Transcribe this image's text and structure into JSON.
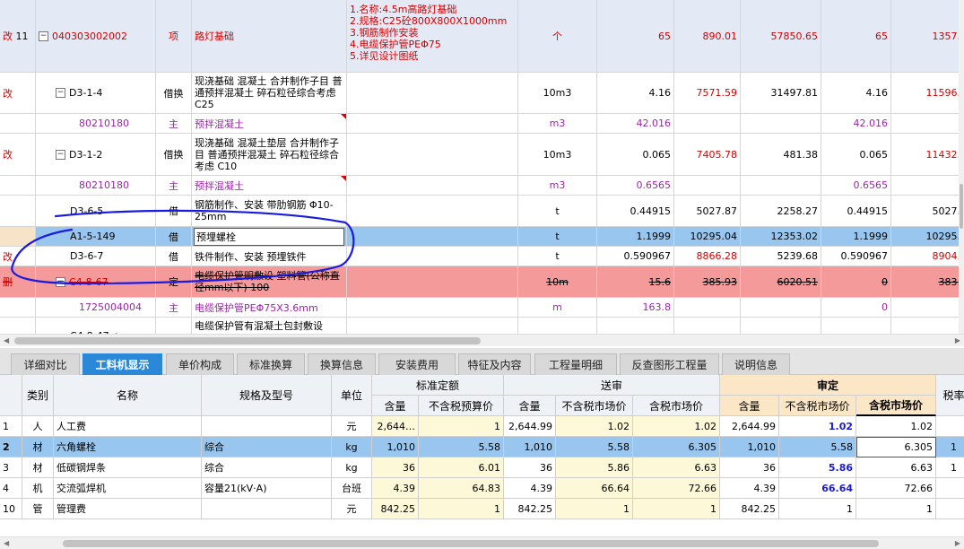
{
  "upper_rows": [
    {
      "flag": "改",
      "num": "11",
      "code": "040303002002",
      "type": "项",
      "name": "路灯基础",
      "features": [
        "1.名称:4.5m高路灯基础",
        "2.规格:C25砼800X800X1000mm",
        "3.钢筋制作安装",
        "4.电缆保护管PEΦ75",
        "5.详见设计图纸"
      ],
      "unit": "个",
      "qty": "65",
      "price": "890.01",
      "total": "57850.65",
      "qty2": "65",
      "p2": "1357."
    },
    {
      "flag": "改",
      "code": "D3-1-4",
      "type": "借换",
      "name": "现浇基础 混凝土 合并制作子目 普通预拌混凝土 碎石粒径综合考虑 C25",
      "unit": "10m3",
      "qty": "4.16",
      "price": "7571.59",
      "total": "31497.81",
      "qty2": "4.16",
      "p2": "11596."
    },
    {
      "code": "80210180",
      "type": "主",
      "name": "预拌混凝土",
      "unit": "m3",
      "qty": "42.016",
      "qty2": "42.016"
    },
    {
      "flag": "改",
      "code": "D3-1-2",
      "type": "借换",
      "name": "现浇基础 混凝土垫层 合并制作子目 普通预拌混凝土 碎石粒径综合考虑 C10",
      "unit": "10m3",
      "qty": "0.065",
      "price": "7405.78",
      "total": "481.38",
      "qty2": "0.065",
      "p2": "11432."
    },
    {
      "code": "80210180",
      "type": "主",
      "name": "预拌混凝土",
      "unit": "m3",
      "qty": "0.6565",
      "qty2": "0.6565"
    },
    {
      "code": "D3-6-5",
      "type": "借",
      "name": "钢筋制作、安装 带肋钢筋 Φ10-25mm",
      "unit": "t",
      "qty": "0.44915",
      "price": "5027.87",
      "total": "2258.27",
      "qty2": "0.44915",
      "p2": "5027."
    },
    {
      "code": "A1-5-149",
      "type": "借",
      "name": "预埋螺栓",
      "unit": "t",
      "qty": "1.1999",
      "price": "10295.04",
      "total": "12353.02",
      "qty2": "1.1999",
      "p2": "10295."
    },
    {
      "flag": "改",
      "code": "D3-6-7",
      "type": "借",
      "name": "铁件制作、安装 预埋铁件",
      "unit": "t",
      "qty": "0.590967",
      "price": "8866.28",
      "total": "5239.68",
      "qty2": "0.590967",
      "p2": "8904."
    },
    {
      "flag": "删",
      "code": "C4-8-67",
      "type": "定",
      "name": "电缆保护管明敷设 塑料管(公称直径mm以下) 100",
      "unit": "10m",
      "qty": "15.6",
      "price": "385.93",
      "total": "6020.51",
      "qty2": "0",
      "p2": "383."
    },
    {
      "code": "1725004004",
      "type": "主",
      "name": "电缆保护管PEΦ75X3.6mm",
      "unit": "m",
      "qty": "163.8",
      "qty2": "0"
    },
    {
      "code": "C4-8-47 +",
      "name": "电缆保护管有混凝土包封敷设"
    }
  ],
  "tabs": [
    "详细对比",
    "工料机显示",
    "单价构成",
    "标准换算",
    "换算信息",
    "安装费用",
    "特征及内容",
    "工程量明细",
    "反查图形工程量",
    "说明信息"
  ],
  "lower": {
    "headers": {
      "category": "类别",
      "name": "名称",
      "spec": "规格及型号",
      "unit": "单位",
      "standard": "标准定额",
      "submitted": "送审",
      "audited": "审定",
      "tax_rate": "税率",
      "qty": "含量",
      "excl_budget": "不含税预算价",
      "excl_market": "不含税市场价",
      "incl_market": "含税市场价"
    },
    "rows": [
      {
        "no": "1",
        "cat": "人",
        "name": "人工费",
        "spec": "",
        "unit": "元",
        "s_qty": "2,644…",
        "s_price": "1",
        "t_qty": "2,644.99",
        "t_excl": "1.02",
        "t_incl": "1.02",
        "a_qty": "2,644.99",
        "a_excl": "1.02",
        "a_incl": "1.02"
      },
      {
        "no": "2",
        "cat": "材",
        "name": "六角螺栓",
        "spec": "综合",
        "unit": "kg",
        "s_qty": "1,010",
        "s_price": "5.58",
        "t_qty": "1,010",
        "t_excl": "5.58",
        "t_incl": "6.305",
        "a_qty": "1,010",
        "a_excl": "5.58",
        "a_incl": "6.305",
        "tax": "1"
      },
      {
        "no": "3",
        "cat": "材",
        "name": "低碳钢焊条",
        "spec": "综合",
        "unit": "kg",
        "s_qty": "36",
        "s_price": "6.01",
        "t_qty": "36",
        "t_excl": "5.86",
        "t_incl": "6.63",
        "a_qty": "36",
        "a_excl": "5.86",
        "a_incl": "6.63",
        "tax": "1"
      },
      {
        "no": "4",
        "cat": "机",
        "name": "交流弧焊机",
        "spec": "容量21(kV·A)",
        "unit": "台班",
        "s_qty": "4.39",
        "s_price": "64.83",
        "t_qty": "4.39",
        "t_excl": "66.64",
        "t_incl": "72.66",
        "a_qty": "4.39",
        "a_excl": "66.64",
        "a_incl": "72.66"
      },
      {
        "no": "10",
        "cat": "管",
        "name": "管理费",
        "spec": "",
        "unit": "元",
        "s_qty": "842.25",
        "s_price": "1",
        "t_qty": "842.25",
        "t_excl": "1",
        "t_incl": "1",
        "a_qty": "842.25",
        "a_excl": "1",
        "a_incl": "1"
      }
    ]
  },
  "colors": {
    "selected_row": "#99c6ee",
    "deleted_row": "#f59a9a",
    "active_tab": "#2b88d8",
    "audit_header": "#fbe6c6",
    "annotation": "#1a1ae0"
  }
}
